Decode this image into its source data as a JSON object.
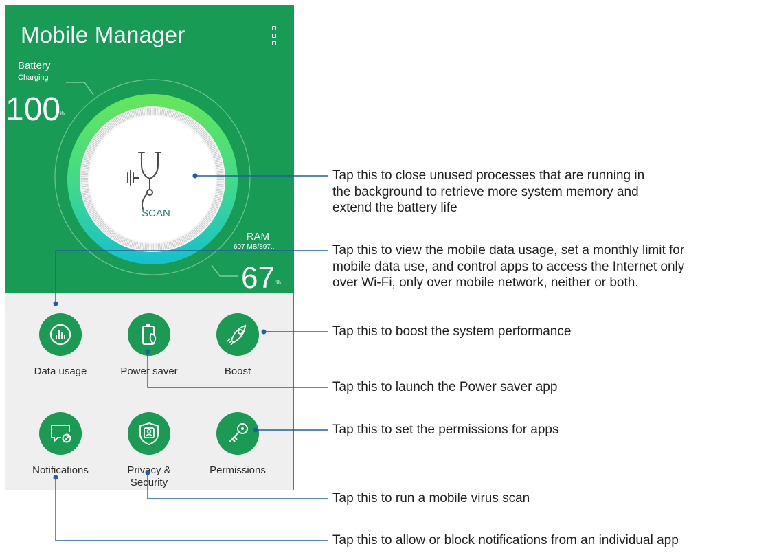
{
  "app": {
    "title": "Mobile Manager",
    "menu_icon": "more-vertical-icon"
  },
  "battery": {
    "label": "Battery",
    "status": "Charging",
    "value": "100",
    "unit": "%"
  },
  "ram": {
    "label": "RAM",
    "usage": "607 MB/897...",
    "value": "67",
    "unit": "%"
  },
  "scan": {
    "label": "SCAN",
    "icon": "stethoscope-icon"
  },
  "tiles": [
    {
      "label": "Data usage",
      "icon": "data-usage-icon"
    },
    {
      "label": "Power saver",
      "icon": "power-saver-icon"
    },
    {
      "label": "Boost",
      "icon": "rocket-icon"
    },
    {
      "label": "Notifications",
      "icon": "notification-block-icon"
    },
    {
      "label": "Privacy & Security",
      "icon": "shield-user-icon"
    },
    {
      "label": "Permissions",
      "icon": "key-icon"
    }
  ],
  "callouts": {
    "scan": [
      "Tap this to close unused processes that are running in",
      "the background to retrieve more system memory and",
      "extend the battery life"
    ],
    "data_usage": [
      "Tap this to view the mobile data usage, set a monthly limit for",
      "mobile data use, and control apps to access the Internet only",
      "over Wi-Fi, only over mobile network, neither or both."
    ],
    "boost": "Tap this to boost the system performance",
    "power_saver": "Tap this to launch the Power saver app",
    "permissions": "Tap this to set the permissions for apps",
    "privacy": "Tap this to run a mobile virus scan",
    "notifications": "Tap this to allow or block notifications from an individual app"
  },
  "colors": {
    "header_green": "#189b55",
    "icon_green": "#1a9a52",
    "gauge_outer": "#5fde63",
    "gauge_inner": "#19c4c8",
    "leader_line": "#1f5ea8",
    "panel_gray": "#efefef"
  }
}
